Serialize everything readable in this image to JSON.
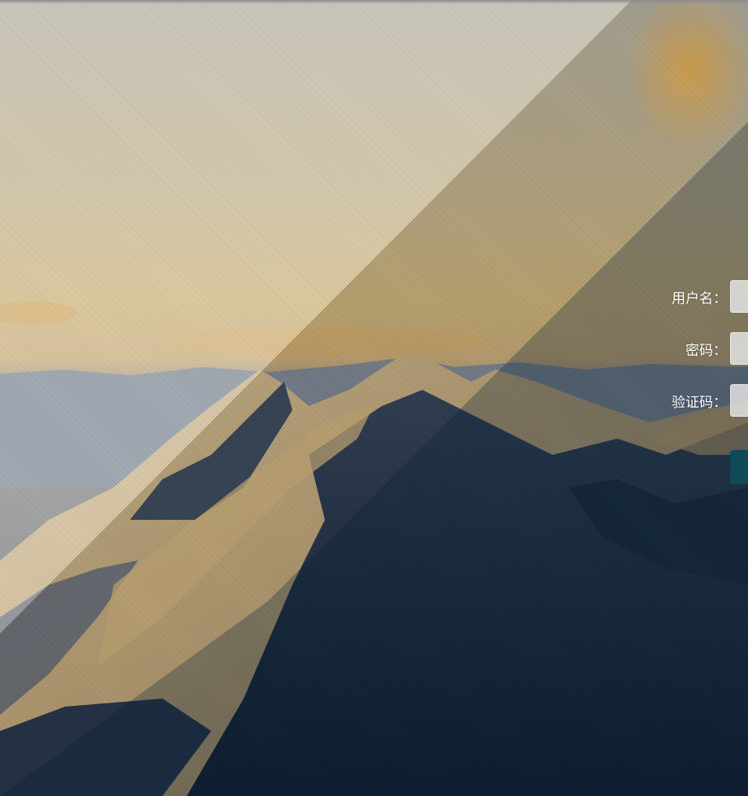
{
  "login": {
    "username_label": "用户名：",
    "username_value": "",
    "password_label": "密码：",
    "password_value": "",
    "captcha_label": "验证码：",
    "captcha_value": "",
    "submit_label": ""
  },
  "colors": {
    "button": "#0e4a58",
    "label_text": "#ffffff",
    "input_bg": "#e6e6e6"
  },
  "background": {
    "description_icon": "mountain-landscape-image"
  }
}
